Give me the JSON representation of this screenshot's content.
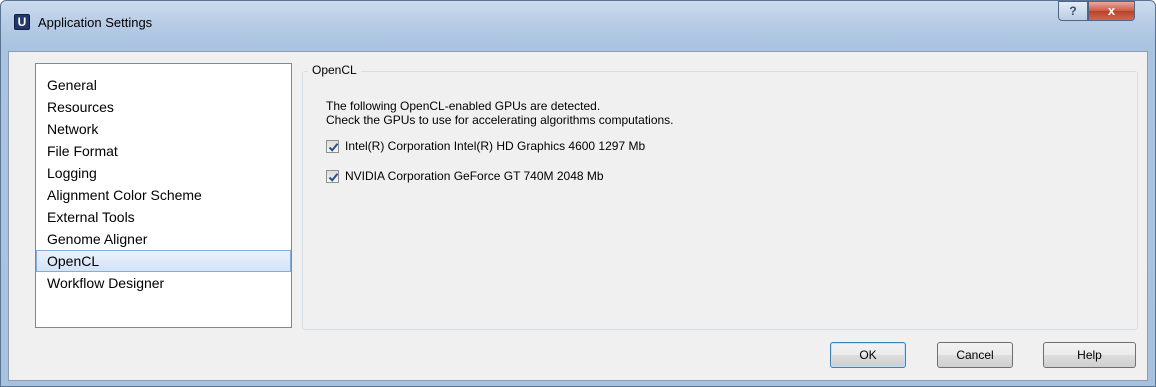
{
  "window": {
    "title": "Application Settings",
    "app_icon_letter": "U",
    "help_glyph": "?",
    "close_glyph": "x"
  },
  "sidebar": {
    "items": [
      {
        "label": "General",
        "selected": false
      },
      {
        "label": "Resources",
        "selected": false
      },
      {
        "label": "Network",
        "selected": false
      },
      {
        "label": "File Format",
        "selected": false
      },
      {
        "label": "Logging",
        "selected": false
      },
      {
        "label": "Alignment Color Scheme",
        "selected": false
      },
      {
        "label": "External Tools",
        "selected": false
      },
      {
        "label": "Genome Aligner",
        "selected": false
      },
      {
        "label": "OpenCL",
        "selected": true
      },
      {
        "label": "Workflow Designer",
        "selected": false
      }
    ]
  },
  "panel": {
    "group_title": "OpenCL",
    "description_line1": "The following OpenCL-enabled GPUs are detected.",
    "description_line2": "Check the GPUs to use for accelerating algorithms computations.",
    "gpus": [
      {
        "label": "Intel(R) Corporation Intel(R) HD Graphics 4600 1297 Mb",
        "checked": true
      },
      {
        "label": "NVIDIA Corporation GeForce GT 740M 2048 Mb",
        "checked": true
      }
    ]
  },
  "buttons": {
    "ok": "OK",
    "cancel": "Cancel",
    "help": "Help"
  },
  "colors": {
    "selection_border": "#84acdd",
    "checkmark": "#2a4f8f"
  }
}
